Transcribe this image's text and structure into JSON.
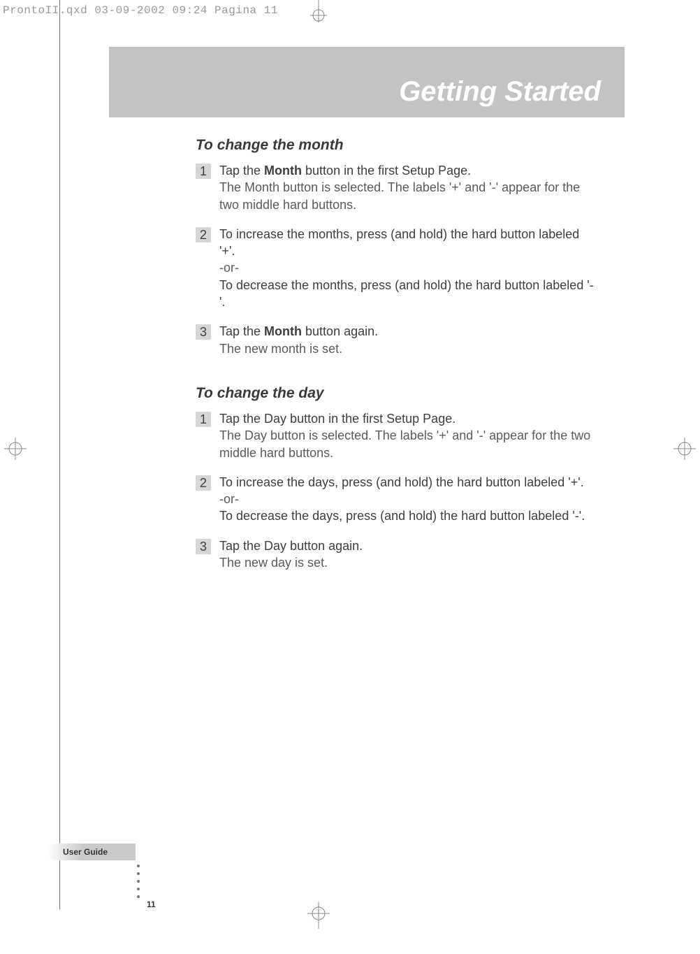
{
  "header_line": "ProntoII.qxd  03-09-2002  09:24  Pagina 11",
  "banner_title": "Getting Started",
  "section_month": {
    "heading": "To change the month",
    "steps": [
      {
        "num": "1",
        "main_pre": "Tap the ",
        "bold": "Month",
        "main_post": " button in the first Setup Page.",
        "sub": "The Month button is selected. The labels '+' and '-' appear for the two middle hard buttons."
      },
      {
        "num": "2",
        "main": "To increase the months, press (and hold) the hard button labeled '+'.",
        "or": "-or-",
        "main2": "To decrease the months, press (and hold) the hard button labeled '-'."
      },
      {
        "num": "3",
        "main_pre": "Tap the ",
        "bold": "Month",
        "main_post": " button again.",
        "sub": "The new month is set."
      }
    ]
  },
  "section_day": {
    "heading": "To change the day",
    "steps": [
      {
        "num": "1",
        "main": "Tap the Day button in the first Setup Page.",
        "sub": "The Day button is selected. The labels '+' and '-' appear for the two middle hard buttons."
      },
      {
        "num": "2",
        "main": "To increase the days, press (and hold) the hard button labeled '+'.",
        "or": "-or-",
        "main2": "To decrease the days, press (and hold) the hard button labeled '-'."
      },
      {
        "num": "3",
        "main": "Tap the Day button again.",
        "sub": "The new day is set."
      }
    ]
  },
  "footer_label": "User Guide",
  "page_number": "11"
}
